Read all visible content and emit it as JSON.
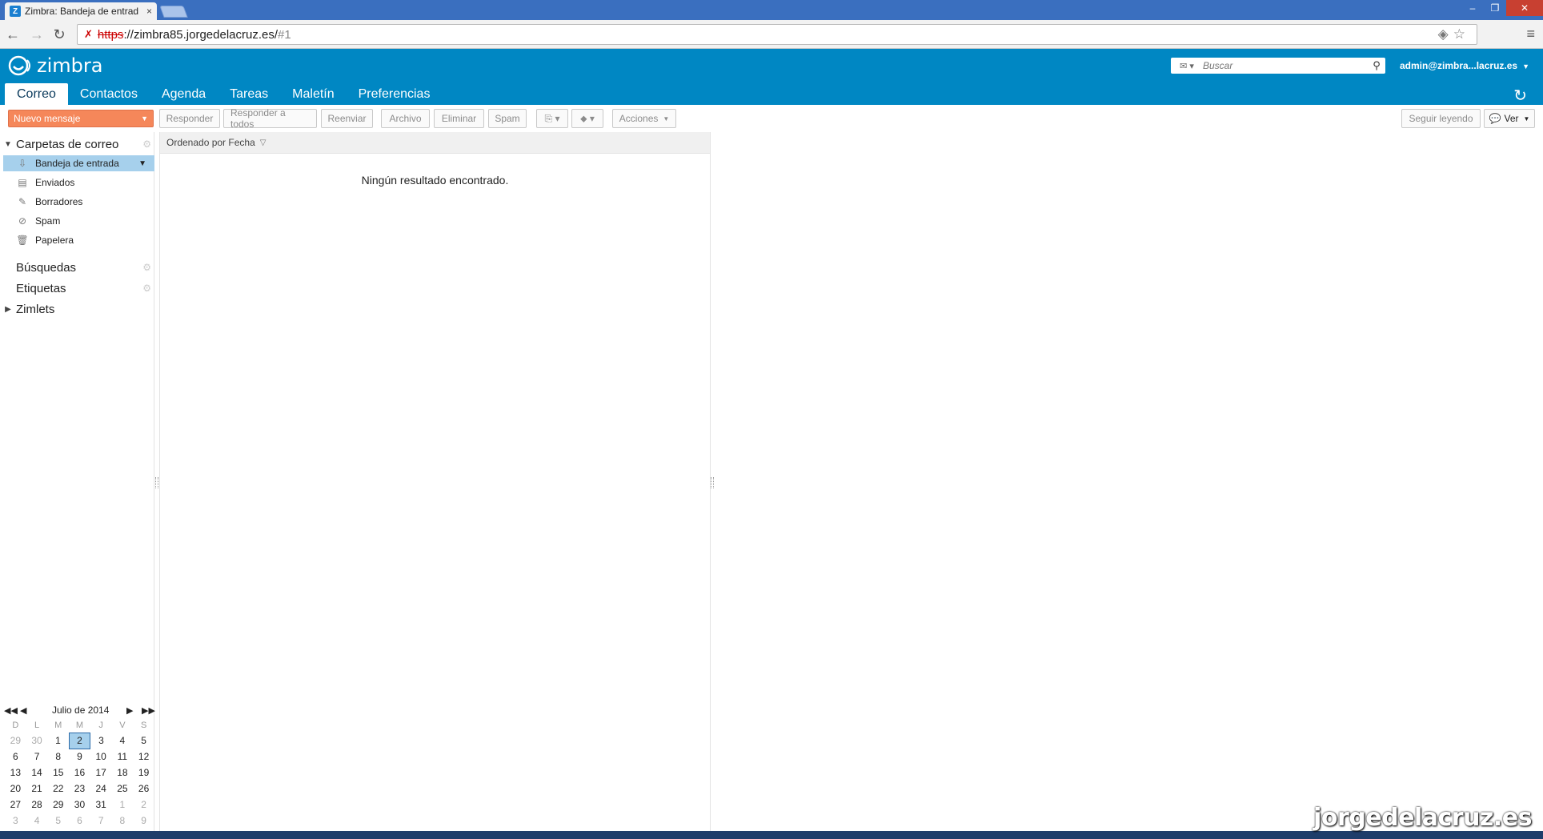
{
  "browser": {
    "tab_title": "Zimbra: Bandeja de entrad",
    "tab_close": "×",
    "url_scheme": "https",
    "url_host": "://zimbra85.jorgedelacruz.es/",
    "url_hash": "#1"
  },
  "app": {
    "logo_text": "zimbra",
    "search_placeholder": "Buscar",
    "user": "admin@zimbra...lacruz.es",
    "tabs": [
      "Correo",
      "Contactos",
      "Agenda",
      "Tareas",
      "Maletín",
      "Preferencias"
    ]
  },
  "toolbar": {
    "new_message": "Nuevo mensaje",
    "reply": "Responder",
    "reply_all": "Responder a todos",
    "forward": "Reenviar",
    "archive": "Archivo",
    "delete": "Eliminar",
    "spam": "Spam",
    "actions": "Acciones",
    "keep_reading": "Seguir leyendo",
    "view": "Ver"
  },
  "sidebar": {
    "mail_folders_header": "Carpetas de correo",
    "folders": [
      {
        "label": "Bandeja de entrada",
        "icon": "inbox-icon",
        "selected": true
      },
      {
        "label": "Enviados",
        "icon": "sent-icon"
      },
      {
        "label": "Borradores",
        "icon": "drafts-icon"
      },
      {
        "label": "Spam",
        "icon": "spam-icon"
      },
      {
        "label": "Papelera",
        "icon": "trash-icon"
      }
    ],
    "searches": "Búsquedas",
    "tags": "Etiquetas",
    "zimlets": "Zimlets"
  },
  "list": {
    "sort_label": "Ordenado por Fecha",
    "empty_message": "Ningún resultado encontrado."
  },
  "calendar": {
    "month_label": "Julio de 2014",
    "weekdays": [
      "D",
      "L",
      "M",
      "M",
      "J",
      "V",
      "S"
    ],
    "weeks": [
      [
        "29",
        "30",
        "1",
        "2",
        "3",
        "4",
        "5"
      ],
      [
        "6",
        "7",
        "8",
        "9",
        "10",
        "11",
        "12"
      ],
      [
        "13",
        "14",
        "15",
        "16",
        "17",
        "18",
        "19"
      ],
      [
        "20",
        "21",
        "22",
        "23",
        "24",
        "25",
        "26"
      ],
      [
        "27",
        "28",
        "29",
        "30",
        "31",
        "1",
        "2"
      ],
      [
        "3",
        "4",
        "5",
        "6",
        "7",
        "8",
        "9"
      ]
    ],
    "today": "2"
  },
  "watermark": "jorgedelacruz.es",
  "colors": {
    "header_blue": "#0087c3",
    "new_message_orange": "#f5875a",
    "selected_folder": "#a6d0ec"
  }
}
